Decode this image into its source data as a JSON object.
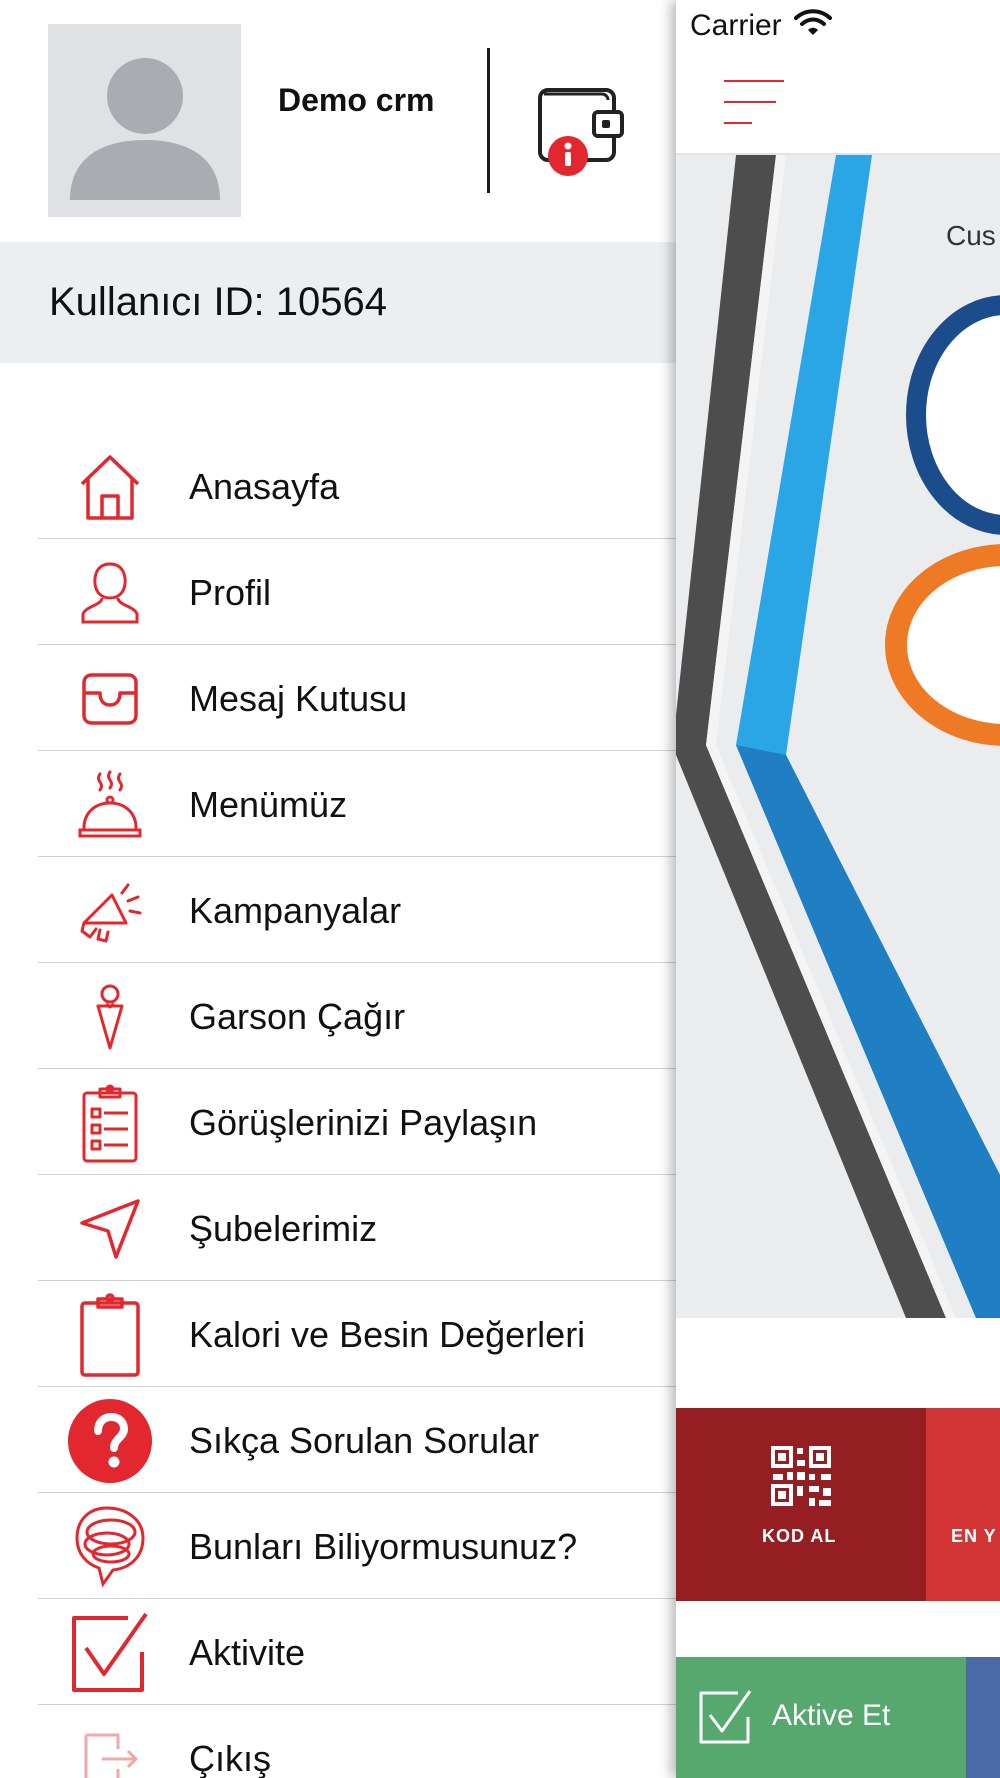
{
  "user": {
    "name": "Demo crm",
    "id_label": "Kullanıcı ID: 10564"
  },
  "menu": {
    "items": [
      {
        "label": "Anasayfa",
        "icon": "home-icon"
      },
      {
        "label": "Profil",
        "icon": "user-icon"
      },
      {
        "label": "Mesaj Kutusu",
        "icon": "inbox-icon"
      },
      {
        "label": "Menümüz",
        "icon": "food-cloche-icon"
      },
      {
        "label": "Kampanyalar",
        "icon": "megaphone-icon"
      },
      {
        "label": "Garson Çağır",
        "icon": "waiter-icon"
      },
      {
        "label": "Görüşlerinizi Paylaşın",
        "icon": "checklist-clipboard-icon"
      },
      {
        "label": "Şubelerimiz",
        "icon": "location-arrow-icon"
      },
      {
        "label": "Kalori ve Besin Değerleri",
        "icon": "clipboard-icon"
      },
      {
        "label": "Sıkça Sorulan Sorular",
        "icon": "question-circle-icon"
      },
      {
        "label": "Bunları Biliyormusunuz?",
        "icon": "chat-bubble-icon"
      },
      {
        "label": "Aktivite",
        "icon": "checkbox-icon"
      },
      {
        "label": "Çıkış",
        "icon": "logout-icon"
      }
    ]
  },
  "main": {
    "status_carrier": "Carrier",
    "hero_text": "Cus",
    "tiles": {
      "kod_al": "KOD AL",
      "second": "EN Y"
    },
    "aktive_label": "Aktive Et"
  },
  "colors": {
    "accent": "#e2272f",
    "id_bar": "#eceff2",
    "tile_kod": "#951e22",
    "tile_second": "#d23536",
    "aktive": "#56a86f",
    "blue_tile": "#4a6aa7"
  }
}
